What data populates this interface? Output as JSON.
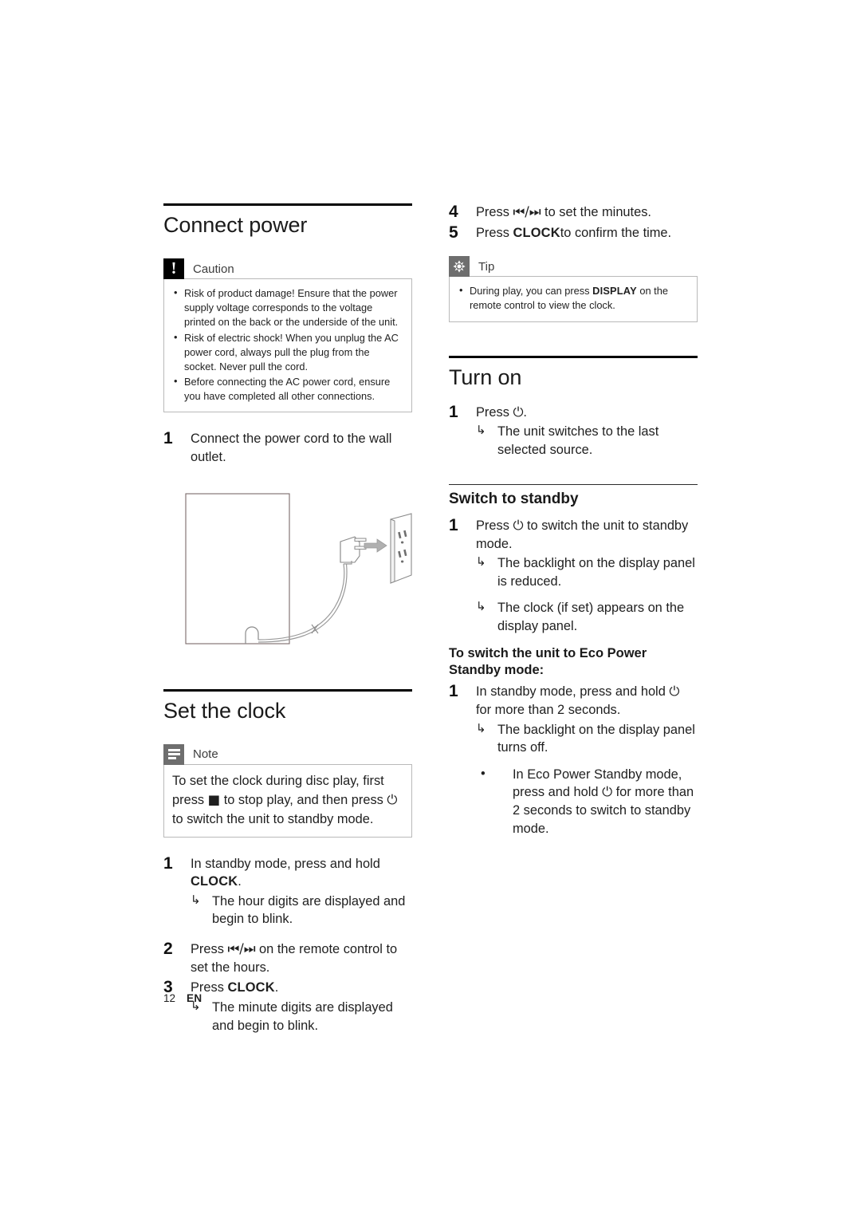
{
  "page": {
    "number": "12",
    "language": "EN"
  },
  "left_column": {
    "connect_power": {
      "heading": "Connect power",
      "caution": {
        "label": "Caution",
        "icon": "exclamation-icon",
        "items": [
          "Risk of product damage! Ensure that the power supply voltage corresponds to the voltage printed on the back or the underside of the unit.",
          "Risk of electric shock! When you unplug the AC power cord, always pull the plug from the socket. Never pull the cord.",
          "Before connecting the AC power cord, ensure you have completed all other connections."
        ]
      },
      "steps": [
        {
          "num": "1",
          "text": "Connect the power cord to the wall outlet."
        }
      ],
      "figure": {
        "name": "power-cord-to-wall-outlet-illustration",
        "parts": [
          "unit-rear-panel",
          "power-cord",
          "ac-plug",
          "direction-arrow",
          "wall-outlet"
        ]
      }
    },
    "set_the_clock": {
      "heading": "Set the clock",
      "note": {
        "label": "Note",
        "icon": "note-lines-icon",
        "text_parts": {
          "a": "To set the clock during disc play, first press ",
          "stop_glyph": "■",
          "b": " to stop play, and then press ",
          "power_glyph": "⏻",
          "c": " to switch the unit to standby mode."
        }
      },
      "steps": [
        {
          "num": "1",
          "text_a": "In standby mode, press and hold ",
          "kbd": "CLOCK",
          "text_b": ".",
          "results": [
            "The hour digits are displayed and begin to blink."
          ]
        },
        {
          "num": "2",
          "text_a": "Press ",
          "glyph": "⏮/⏭",
          "text_b": " on the remote control to set the hours.",
          "results": []
        },
        {
          "num": "3",
          "text_a": "Press ",
          "kbd": "CLOCK",
          "text_b": ".",
          "results": [
            "The minute digits are displayed and begin to blink."
          ]
        }
      ]
    }
  },
  "right_column": {
    "clock_steps_continued": [
      {
        "num": "4",
        "text_a": "Press ",
        "glyph": "⏮/⏭",
        "text_b": " to set the minutes."
      },
      {
        "num": "5",
        "text_a": "Press ",
        "kbd": "CLOCK",
        "text_b": "to confirm the time."
      }
    ],
    "tip": {
      "label": "Tip",
      "icon": "asterisk-starburst-icon",
      "text_a": "During play, you can press ",
      "kbd": "DISPLAY",
      "text_b": " on the remote control to view the clock."
    },
    "turn_on": {
      "heading": "Turn on",
      "steps": [
        {
          "num": "1",
          "text_a": "Press ",
          "power_glyph": "⏻",
          "text_b": ".",
          "results": [
            "The unit switches to the last selected source."
          ]
        }
      ]
    },
    "switch_to_standby": {
      "heading": "Switch to standby",
      "steps": [
        {
          "num": "1",
          "text_a": "Press ",
          "power_glyph": "⏻",
          "text_b": " to switch the unit to standby mode.",
          "results": [
            "The backlight on the display panel is reduced.",
            "The clock (if set) appears on the display panel."
          ]
        }
      ],
      "eco_heading": "To switch the unit to Eco Power Standby mode:",
      "eco_steps": [
        {
          "num": "1",
          "text_a": "In standby mode, press and hold ",
          "power_glyph": "⏻",
          "text_b": " for more than 2 seconds.",
          "results": [
            "The backlight on the display panel turns off."
          ],
          "subdots_parts": {
            "a": "In Eco Power Standby mode, press and hold ",
            "power_glyph": "⏻",
            "b": " for more than 2 seconds to switch to standby mode."
          }
        }
      ]
    }
  }
}
